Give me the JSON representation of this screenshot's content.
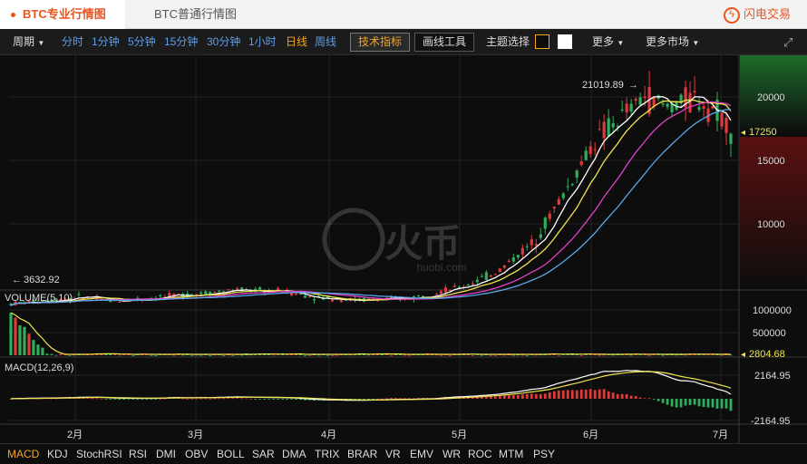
{
  "tabs": [
    {
      "label": "BTC专业行情图",
      "active": true
    },
    {
      "label": "BTC普通行情图",
      "active": false
    }
  ],
  "brand": {
    "label": "闪电交易",
    "icon": "lightning-icon"
  },
  "toolbar": {
    "period_label": "周期",
    "timeframes": [
      "分时",
      "1分钟",
      "5分钟",
      "15分钟",
      "30分钟",
      "1小时",
      "日线",
      "周线"
    ],
    "active_timeframe": "日线",
    "tech_indicator_label": "技术指标",
    "drawing_tools_label": "画线工具",
    "theme_label": "主题选择",
    "theme_colors": [
      "#f5a623",
      "#ffffff"
    ],
    "more_label": "更多",
    "more_markets_label": "更多市场",
    "fullscreen_icon": "fullscreen-icon"
  },
  "watermark": {
    "text": "huobi.com"
  },
  "price_axis": {
    "ticks": [
      "20000",
      "15000",
      "10000"
    ]
  },
  "price_marks": {
    "high": "21019.89",
    "low": "3632.92",
    "last": "17250"
  },
  "volume_panel": {
    "label": "VOLUME(5,10)",
    "ticks": [
      "1000000",
      "500000"
    ],
    "last": "2804.68"
  },
  "macd_panel": {
    "label": "MACD(12,26,9)",
    "ticks": [
      "2164.95",
      "-2164.95"
    ]
  },
  "time_axis": {
    "labels": [
      "2月",
      "3月",
      "4月",
      "5月",
      "6月",
      "7月"
    ]
  },
  "indicators": [
    "MACD",
    "KDJ",
    "StochRSI",
    "RSI",
    "DMI",
    "OBV",
    "BOLL",
    "SAR",
    "DMA",
    "TRIX",
    "BRAR",
    "VR",
    "EMV",
    "WR",
    "ROC",
    "MTM",
    "PSY"
  ],
  "active_indicator": "MACD",
  "colors": {
    "up": "#e03a3a",
    "down": "#2fae5c",
    "ma5": "#ffffff",
    "ma10": "#f0e44c",
    "ma20": "#e040c8",
    "ma30": "#5aa8e8",
    "accent": "#f5a623"
  }
}
